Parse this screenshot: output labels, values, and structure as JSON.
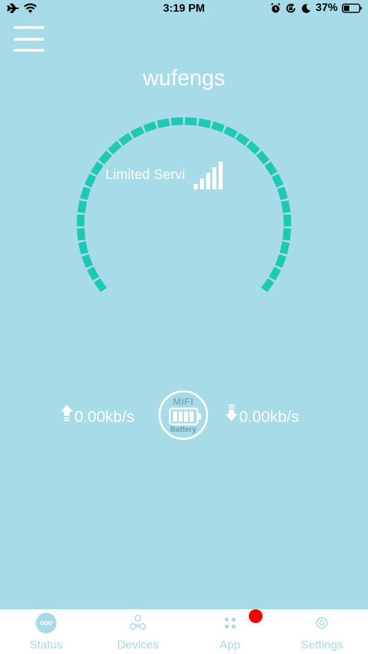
{
  "status_bar": {
    "time": "3:19 PM",
    "battery_percent": "37%",
    "battery_level": 0.37,
    "icons": [
      "airplane-icon",
      "wifi-icon",
      "alarm-icon",
      "rotation-lock-icon",
      "moon-icon",
      "battery-icon"
    ]
  },
  "header": {
    "menu_icon": "hamburger-menu-icon",
    "network_name": "wufengs"
  },
  "gauge": {
    "service_status": "Limited Service",
    "signal_bars": 5,
    "signal_bars_active": 5,
    "accent_color": "#1ec8b3"
  },
  "speeds": {
    "upload": "0.00kb/s",
    "download": "0.00kb/s"
  },
  "battery_badge": {
    "top_label": "MIFI",
    "bottom_label": "Battery"
  },
  "tabs": [
    {
      "label": "Status",
      "icon": "status-dots-icon",
      "active": true
    },
    {
      "label": "Devices",
      "icon": "devices-icon",
      "active": false
    },
    {
      "label": "App",
      "icon": "app-grid-icon",
      "active": false,
      "has_badge": true
    },
    {
      "label": "Settings",
      "icon": "gear-icon",
      "active": false
    }
  ],
  "colors": {
    "background": "#a6dbe7",
    "gauge": "#1ec8b3",
    "badge": "#ff0000"
  }
}
